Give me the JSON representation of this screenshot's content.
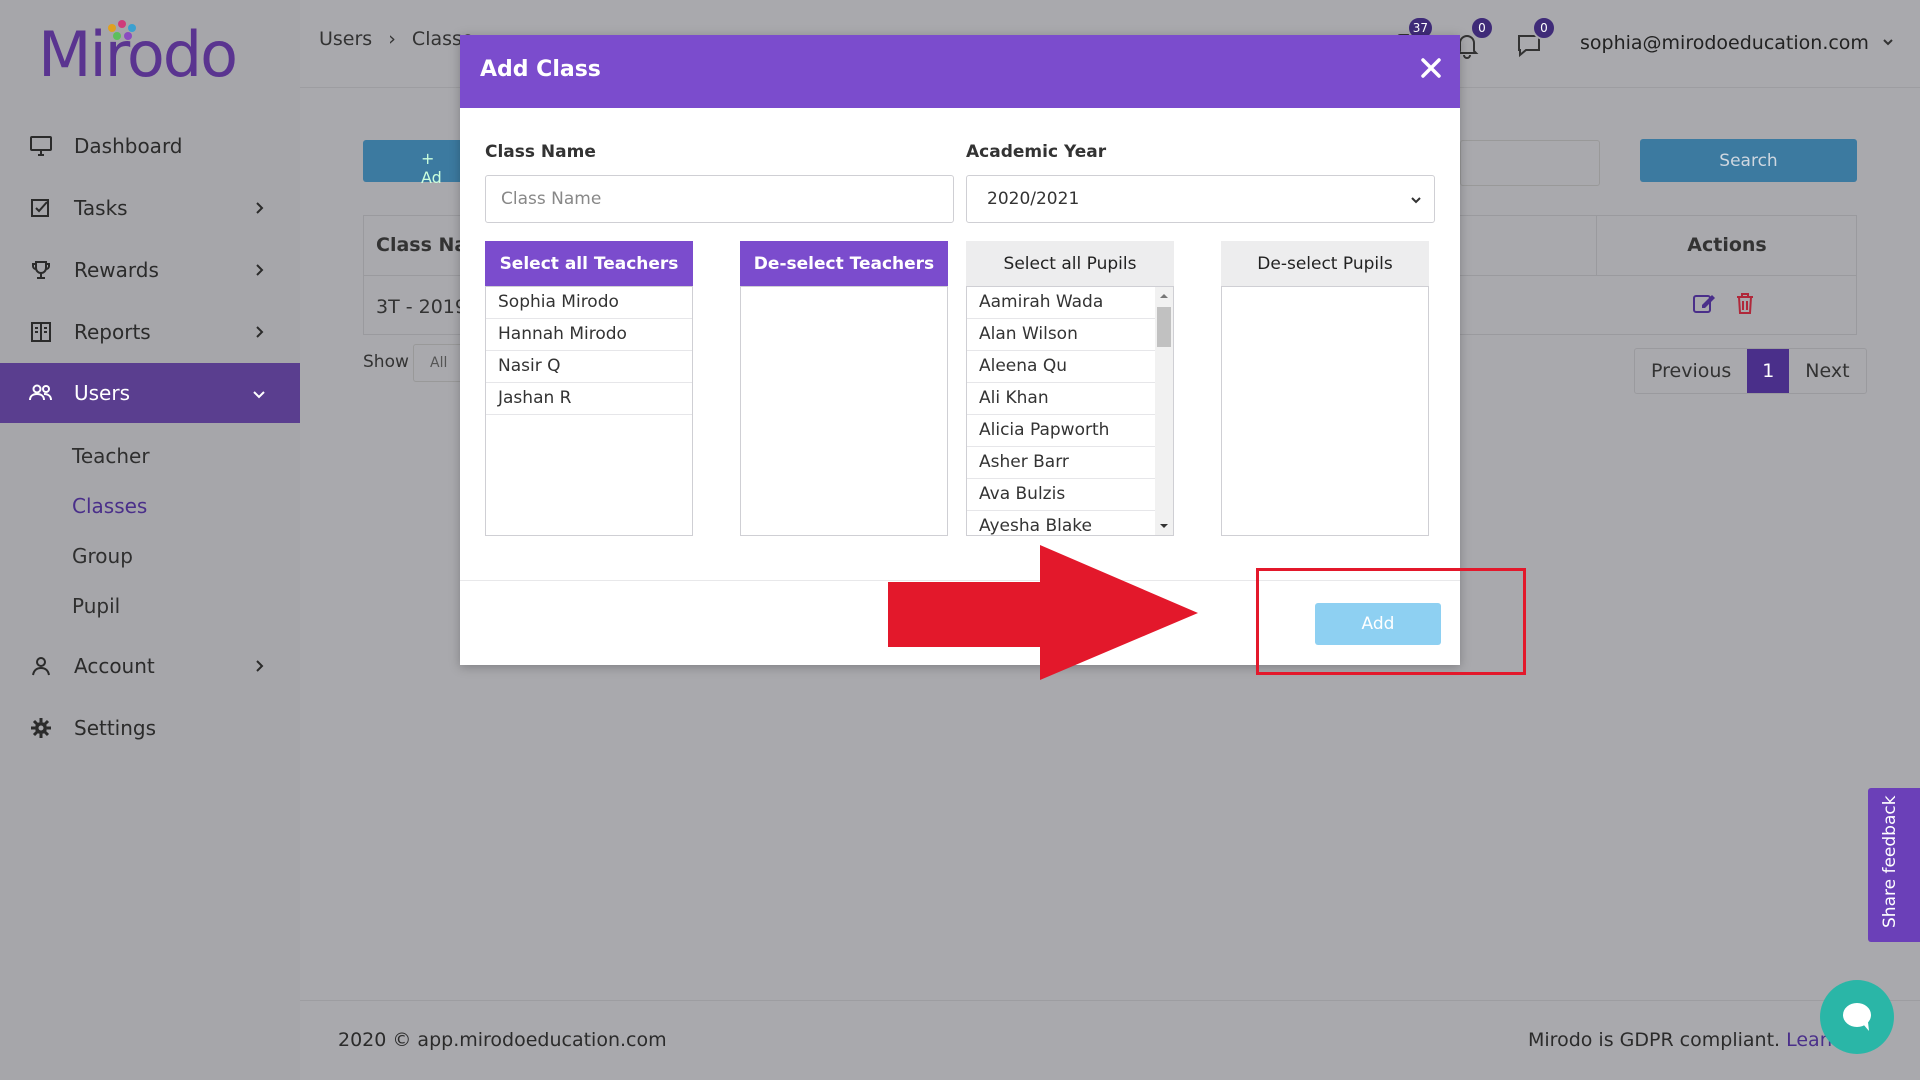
{
  "sidebar": {
    "brand": "Mirodo",
    "items": [
      {
        "label": "Dashboard",
        "icon": "monitor-icon",
        "has_chevron": false
      },
      {
        "label": "Tasks",
        "icon": "tasks-icon",
        "has_chevron": true
      },
      {
        "label": "Rewards",
        "icon": "trophy-icon",
        "has_chevron": true
      },
      {
        "label": "Reports",
        "icon": "reports-icon",
        "has_chevron": true
      },
      {
        "label": "Users",
        "icon": "users-icon",
        "has_chevron": true,
        "active": true
      }
    ],
    "sub_items": [
      "Teacher",
      "Classes",
      "Group",
      "Pupil"
    ],
    "current_sub": "Classes",
    "bottom_items": [
      {
        "label": "Account",
        "icon": "account-icon",
        "has_chevron": true
      },
      {
        "label": "Settings",
        "icon": "gear-icon",
        "has_chevron": false
      }
    ]
  },
  "topbar": {
    "breadcrumb": [
      "Users",
      "Classe"
    ],
    "badges": {
      "tasks": "37",
      "notifications": "0",
      "messages": "0"
    },
    "user_email": "sophia@mirodoeducation.com"
  },
  "background": {
    "add_button": "+ Ad",
    "search_button": "Search",
    "table_header_first": "Class Na",
    "table_header_actions": "Actions",
    "row_first": "3T - 2019",
    "show_label": "Show",
    "show_value": "All",
    "pager": {
      "previous": "Previous",
      "page": "1",
      "next": "Next"
    }
  },
  "modal": {
    "title": "Add Class",
    "class_name_label": "Class Name",
    "class_name_placeholder": "Class Name",
    "class_name_value": "",
    "academic_year_label": "Academic Year",
    "academic_year_value": "2020/2021",
    "select_all_teachers": "Select all Teachers",
    "deselect_teachers": "De-select Teachers",
    "select_all_pupils": "Select all Pupils",
    "deselect_pupils": "De-select Pupils",
    "teachers": [
      "Sophia Mirodo",
      "Hannah Mirodo",
      "Nasir Q",
      "Jashan R"
    ],
    "pupils": [
      "Aamirah Wada",
      "Alan Wilson",
      "Aleena Qu",
      "Ali Khan",
      "Alicia Papworth",
      "Asher Barr",
      "Ava Bulzis",
      "Ayesha Blake"
    ],
    "add_button": "Add"
  },
  "footer": {
    "copyright": "2020 © app.mirodoeducation.com",
    "gdpr": "Mirodo is GDPR compliant.",
    "learn": "Learn"
  },
  "feedback_tab": "Share feedback",
  "colors": {
    "brand_purple": "#7b4ccd",
    "active_nav": "#5a3e8f",
    "add_button": "#8ed0f2",
    "annotation_red": "#e3182b",
    "chat_teal": "#2ab6a7"
  }
}
